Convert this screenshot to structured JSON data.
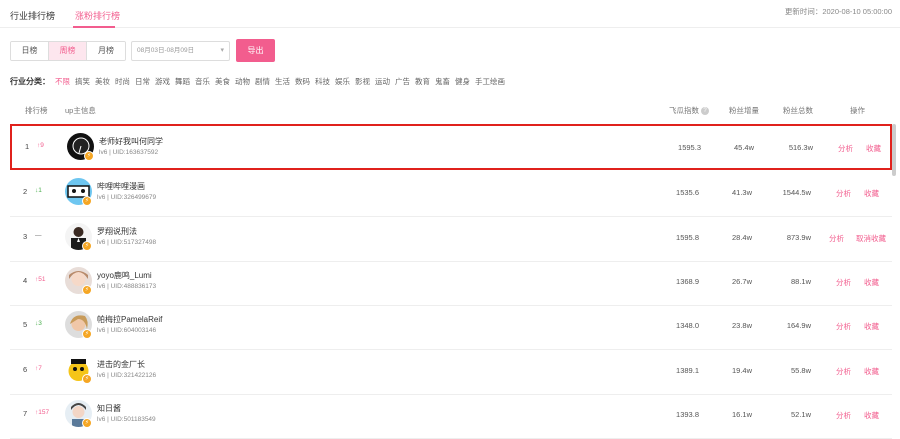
{
  "tabs": [
    {
      "label": "行业排行榜",
      "active": false
    },
    {
      "label": "涨粉排行榜",
      "active": true
    }
  ],
  "update_time": "更新时间：2020-08-10 05:00:00",
  "period": {
    "buttons": [
      "日榜",
      "周榜",
      "月榜"
    ],
    "selected": "周榜"
  },
  "date_range": {
    "placeholder": "08月03日-08月09日"
  },
  "export_label": "导出",
  "categories": {
    "title": "行业分类：",
    "items": [
      "不限",
      "搞笑",
      "美妆",
      "时尚",
      "日常",
      "游戏",
      "舞蹈",
      "音乐",
      "美食",
      "动物",
      "剧情",
      "生活",
      "数码",
      "科技",
      "娱乐",
      "影视",
      "运动",
      "广告",
      "教育",
      "鬼畜",
      "健身",
      "手工绘画"
    ],
    "selected": "不限"
  },
  "table": {
    "headers": {
      "rank": "排行榜",
      "up": "up主信息",
      "flying": "飞瓜指数",
      "gain": "粉丝增量",
      "total": "粉丝总数",
      "ops": "操作"
    },
    "rows": [
      {
        "rank": "1",
        "change": "↑9",
        "dir": "up",
        "name": "老师好我叫何同学",
        "meta": "lv6 | UID:163637592",
        "flying": "1595.3",
        "gain": "45.4w",
        "total": "516.3w",
        "ops": [
          "分析",
          "收藏"
        ]
      },
      {
        "rank": "2",
        "change": "↓1",
        "dir": "down",
        "name": "哔哩哔哩漫画",
        "meta": "lv6 | UID:326499679",
        "flying": "1535.6",
        "gain": "41.3w",
        "total": "1544.5w",
        "ops": [
          "分析",
          "收藏"
        ]
      },
      {
        "rank": "3",
        "change": "—",
        "dir": "same",
        "name": "罗翔说刑法",
        "meta": "lv6 | UID:517327498",
        "flying": "1595.8",
        "gain": "28.4w",
        "total": "873.9w",
        "ops": [
          "分析",
          "取消收藏"
        ]
      },
      {
        "rank": "4",
        "change": "↑51",
        "dir": "up",
        "name": "yoyo鹿鸣_Lumi",
        "meta": "lv6 | UID:488836173",
        "flying": "1368.9",
        "gain": "26.7w",
        "total": "88.1w",
        "ops": [
          "分析",
          "收藏"
        ]
      },
      {
        "rank": "5",
        "change": "↓3",
        "dir": "down",
        "name": "帕梅拉PamelaReif",
        "meta": "lv6 | UID:604003146",
        "flying": "1348.0",
        "gain": "23.8w",
        "total": "164.9w",
        "ops": [
          "分析",
          "收藏"
        ]
      },
      {
        "rank": "6",
        "change": "↑7",
        "dir": "up",
        "name": "进击的金厂长",
        "meta": "lv6 | UID:321422126",
        "flying": "1389.1",
        "gain": "19.4w",
        "total": "55.8w",
        "ops": [
          "分析",
          "收藏"
        ]
      },
      {
        "rank": "7",
        "change": "↑157",
        "dir": "up",
        "name": "知日酱",
        "meta": "lv6 | UID:501183549",
        "flying": "1393.8",
        "gain": "16.1w",
        "total": "52.1w",
        "ops": [
          "分析",
          "收藏"
        ]
      }
    ]
  },
  "colors": {
    "accent": "#f25d8e",
    "highlight_border": "#e0211c",
    "down": "#4caf50"
  }
}
